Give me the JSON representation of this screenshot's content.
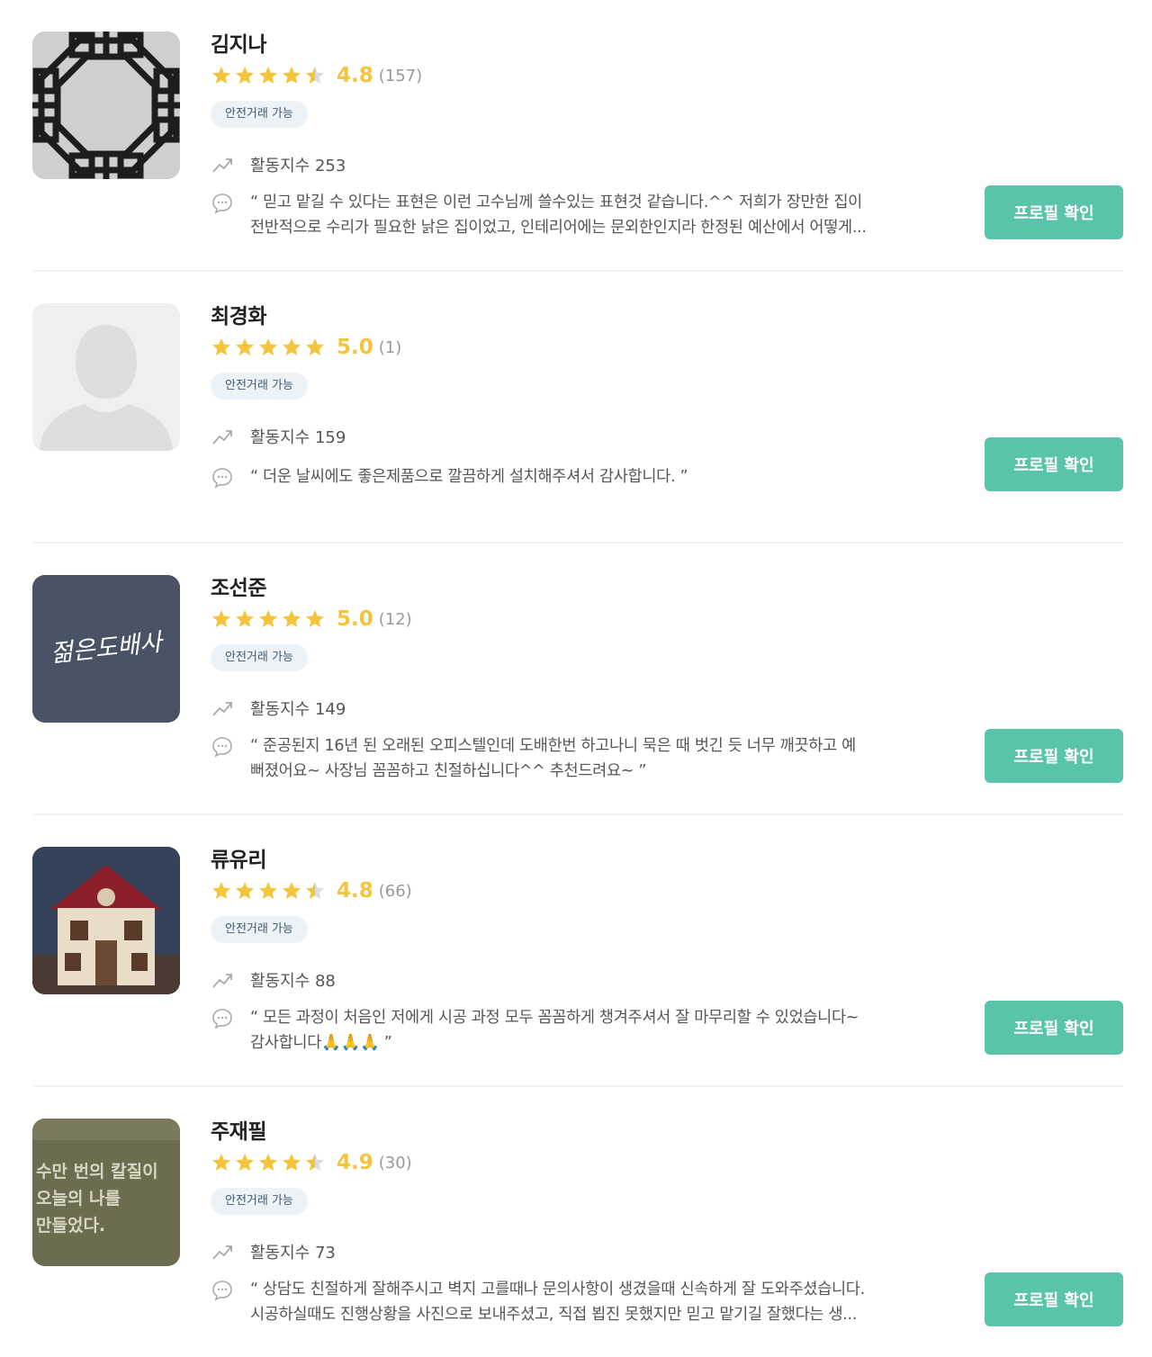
{
  "experts": [
    {
      "name": "김지나",
      "rating": 4.8,
      "rating_text": "4.8",
      "review_count": "(157)",
      "badge": "안전거래 가능",
      "activity": "활동지수 253",
      "review_line1": "“ 믿고 맡길 수 있다는 표현은 이런 고수님께 쓸수있는 표현것 같습니다.^^ 저희가 장만한 집이",
      "review_line2": "전반적으로 수리가 필요한 낡은 집이었고, 인테리어에는 문외한인지라 한정된 예산에서 어떻게...",
      "button": "프로필 확인",
      "avatar": "window-lattice-photo"
    },
    {
      "name": "최경화",
      "rating": 5.0,
      "rating_text": "5.0",
      "review_count": "(1)",
      "badge": "안전거래 가능",
      "activity": "활동지수 159",
      "review_line1": "“ 더운 날씨에도 좋은제품으로 깔끔하게 설치해주셔서 감사합니다. ”",
      "review_line2": "",
      "button": "프로필 확인",
      "avatar": "default-person-icon"
    },
    {
      "name": "조선준",
      "rating": 5.0,
      "rating_text": "5.0",
      "review_count": "(12)",
      "badge": "안전거래 가능",
      "activity": "활동지수 149",
      "review_line1": "“ 준공된지 16년 된 오래된 오피스텔인데 도배한번 하고나니 묵은 때 벗긴 듯 너무 깨끗하고 예",
      "review_line2": "뻐졌어요~ 사장님 꼼꼼하고 친절하십니다^^ 추천드려요~ ”",
      "button": "프로필 확인",
      "avatar": "logo-text",
      "avatar_text": "젊은도배사"
    },
    {
      "name": "류유리",
      "rating": 4.8,
      "rating_text": "4.8",
      "review_count": "(66)",
      "badge": "안전거래 가능",
      "activity": "활동지수 88",
      "review_line1": "“ 모든 과정이 처음인 저에게 시공 과정 모두 꼼꼼하게 챙겨주셔서 잘 마무리할 수 있었습니다~",
      "review_line2": "감사합니다🙏🙏🙏 ”",
      "button": "프로필 확인",
      "avatar": "toy-house-photo"
    },
    {
      "name": "주재필",
      "rating": 4.9,
      "rating_text": "4.9",
      "review_count": "(30)",
      "badge": "안전거래 가능",
      "activity": "활동지수 73",
      "review_line1": "“ 상담도 친절하게 잘해주시고 벽지 고를때나 문의사항이 생겼을때 신속하게 잘 도와주셨습니다.",
      "review_line2": "시공하실때도 진행상황을 사진으로 보내주셨고, 직접 뵙진 못했지만 믿고 맡기길 잘했다는 생...",
      "button": "프로필 확인",
      "avatar": "embroidered-text-photo",
      "avatar_lines": [
        "수만 번의 칼질이",
        "오늘의 나를",
        "만들었다."
      ]
    }
  ],
  "colors": {
    "star": "#f5c43d",
    "button": "#5ac4aa",
    "badge_bg": "#ecf2f6",
    "badge_text": "#3e5a76"
  }
}
